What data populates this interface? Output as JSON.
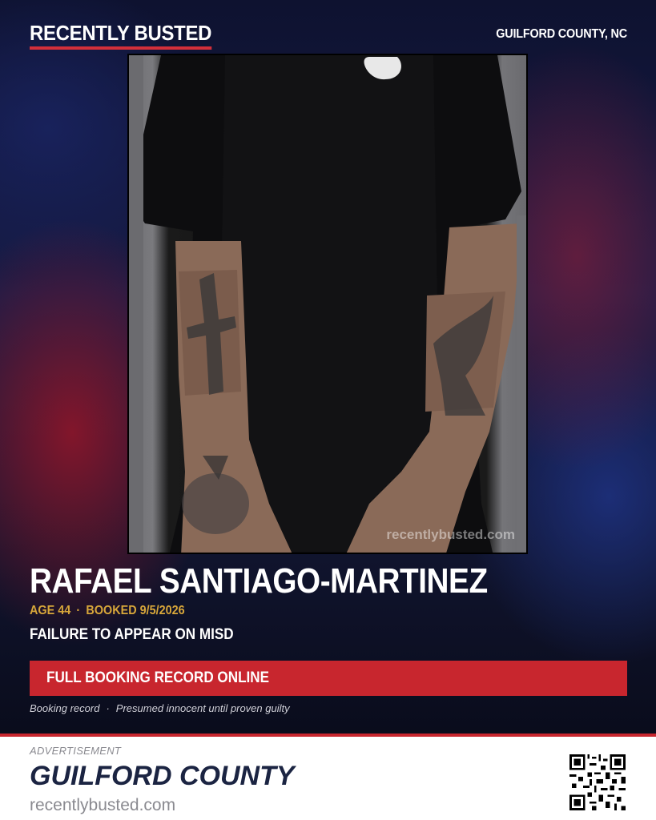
{
  "header": {
    "brand": "RECENTLY BUSTED",
    "county": "GUILFORD COUNTY, NC"
  },
  "photo": {
    "watermark": "recentlybusted.com"
  },
  "record": {
    "name": "RAFAEL SANTIAGO-MARTINEZ",
    "age": "AGE 44",
    "booked": "BOOKED 9/5/2026",
    "separator": "·",
    "charge": "FAILURE TO APPEAR ON MISD"
  },
  "cta": {
    "label": "FULL BOOKING RECORD ONLINE"
  },
  "disclaimer": {
    "left": "Booking record",
    "separator": "·",
    "right": "Presumed innocent until proven guilty"
  },
  "footer": {
    "ad_label": "ADVERTISEMENT",
    "county": "GUILFORD COUNTY",
    "url": "recentlybusted.com"
  },
  "colors": {
    "accent_red": "#c8262e",
    "gold": "#d8a73a",
    "navy": "#1b2442"
  },
  "icons": {
    "qr": "qr-code-icon"
  }
}
